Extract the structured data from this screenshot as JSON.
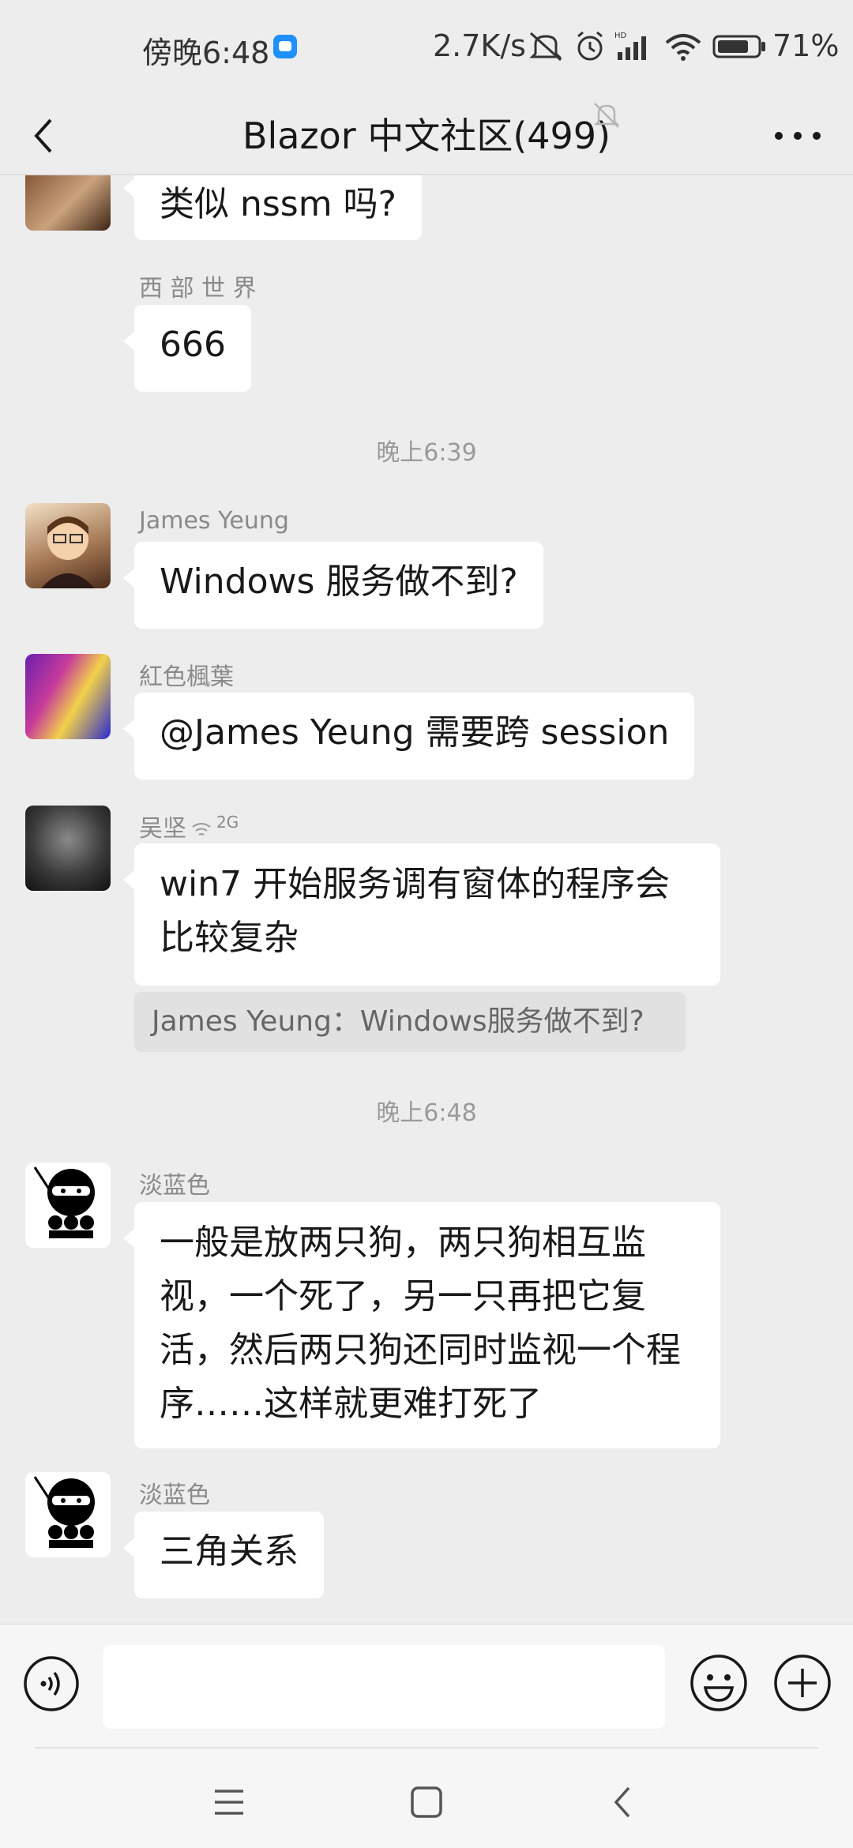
{
  "status_bar": {
    "time": "傍晚6:48",
    "speed": "2.7K/s",
    "battery": "71%",
    "app_icon_color": "#1e90ff"
  },
  "header": {
    "title": "Blazor 中文社区(499)",
    "back_icon": "chevron-left-icon",
    "mute_icon": "bell-off-icon",
    "more_icon": "more-icon"
  },
  "messages": [
    {
      "id": "m0",
      "sender": "",
      "text": "类似 nssm 吗?"
    },
    {
      "id": "m1",
      "sender": "西 部 世 界",
      "text": "666"
    },
    {
      "id": "t1",
      "timestamp": "晚上6:39"
    },
    {
      "id": "m2",
      "sender": "James Yeung",
      "text": "Windows 服务做不到?"
    },
    {
      "id": "m3",
      "sender": "紅色楓葉",
      "text": "@James Yeung  需要跨 session"
    },
    {
      "id": "m4",
      "sender": "吴坚",
      "sender_badge": "2G",
      "text_lines": [
        "win7 开始服务调有窗体的程序会",
        "比较复杂"
      ],
      "quote": "James Yeung：Windows服务做不到?"
    },
    {
      "id": "t2",
      "timestamp": "晚上6:48"
    },
    {
      "id": "m5",
      "sender": "淡蓝色",
      "text_lines": [
        "一般是放两只狗，两只狗相互监",
        "视，一个死了，另一只再把它复",
        "活，然后两只狗还同时监视一个程",
        "序……这样就更难打死了"
      ]
    },
    {
      "id": "m6",
      "sender": "淡蓝色",
      "text": "三角关系"
    }
  ],
  "input_bar": {
    "voice_icon": "voice-icon",
    "placeholder": "",
    "emoji_icon": "emoji-icon",
    "plus_icon": "plus-icon"
  },
  "system_nav": {
    "menu_icon": "menu-icon",
    "home_icon": "home-icon",
    "back_icon": "back-icon"
  }
}
